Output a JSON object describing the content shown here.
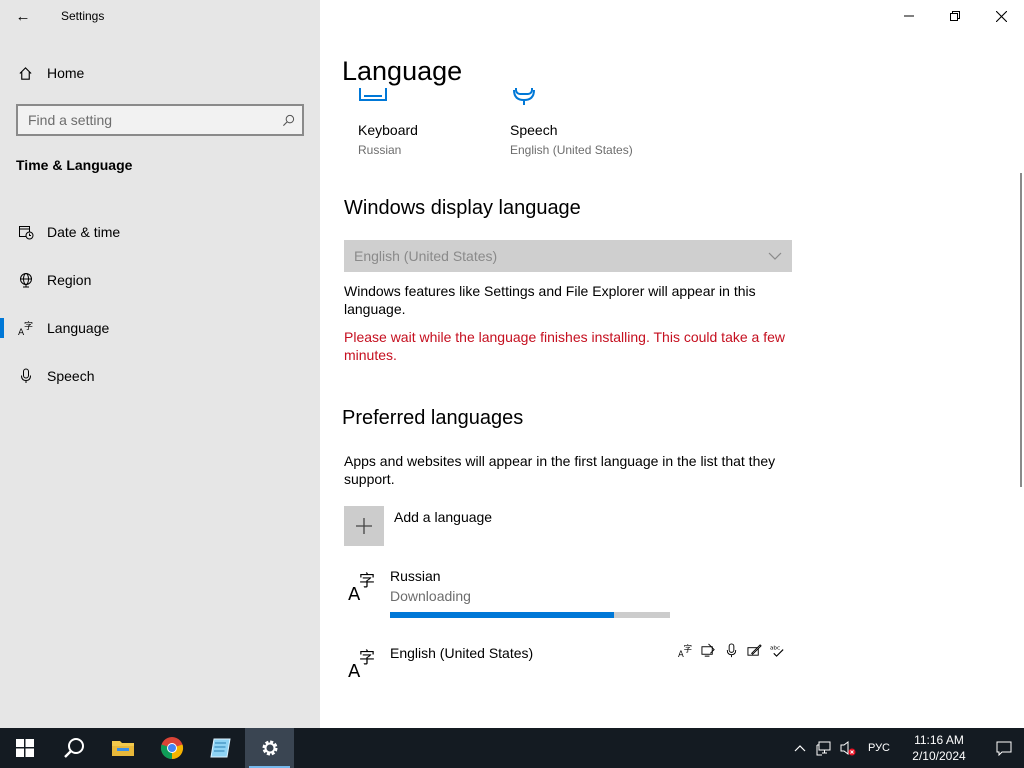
{
  "window": {
    "title": "Settings",
    "accent_color": "#0078d7",
    "warning_color": "#c50f1f"
  },
  "sidebar": {
    "home_label": "Home",
    "search_placeholder": "Find a setting",
    "section_title": "Time & Language",
    "items": [
      {
        "label": "Date & time",
        "icon": "calendar-clock-icon",
        "active": false
      },
      {
        "label": "Region",
        "icon": "globe-icon",
        "active": false
      },
      {
        "label": "Language",
        "icon": "language-icon",
        "active": true
      },
      {
        "label": "Speech",
        "icon": "microphone-icon",
        "active": false
      }
    ]
  },
  "main": {
    "title": "Language",
    "tiles": [
      {
        "name": "Keyboard",
        "sub": "Russian",
        "icon": "keyboard-icon"
      },
      {
        "name": "Speech",
        "sub": "English (United States)",
        "icon": "speech-icon"
      }
    ],
    "display_language": {
      "heading": "Windows display language",
      "selected": "English (United States)",
      "description": "Windows features like Settings and File Explorer will appear in this language.",
      "warning": "Please wait while the language finishes installing. This could take a few minutes."
    },
    "preferred": {
      "heading": "Preferred languages",
      "description": "Apps and websites will appear in the first language in the list that they support.",
      "add_label": "Add a language",
      "languages": [
        {
          "name": "Russian",
          "status": "Downloading",
          "progress": 0.8
        },
        {
          "name": "English (United States)",
          "features": [
            "language-pack-icon",
            "display-language-icon",
            "speech-mic-icon",
            "handwriting-icon",
            "spellcheck-icon"
          ]
        }
      ]
    }
  },
  "taskbar": {
    "apps": [
      "start-icon",
      "search-icon",
      "file-explorer-icon",
      "chrome-icon",
      "notepad-icon",
      "settings-icon"
    ],
    "input_language": "РУС",
    "time": "11:16 AM",
    "date": "2/10/2024"
  }
}
